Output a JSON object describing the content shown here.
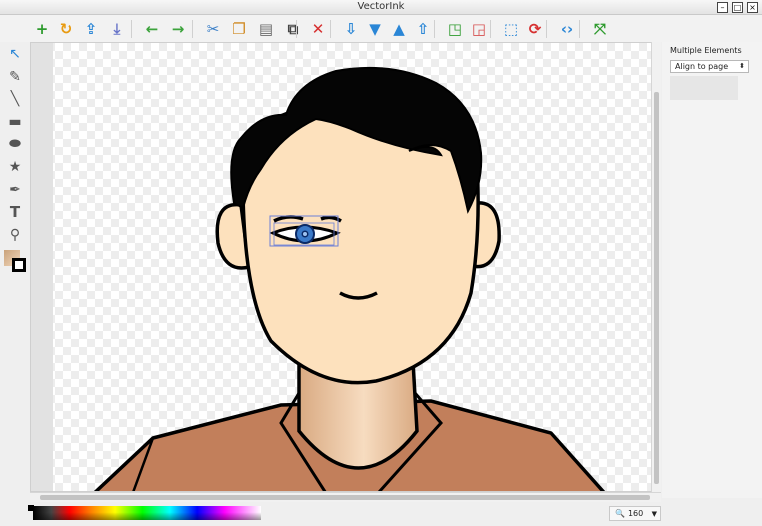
{
  "window": {
    "title": "VectorInk"
  },
  "toolbar": [
    {
      "name": "new-button",
      "glyph": "+",
      "color": "#2e9b2e"
    },
    {
      "name": "reload-button",
      "glyph": "↻",
      "color": "#e89b12"
    },
    {
      "name": "upload-button",
      "glyph": "⇪",
      "color": "#2a86d6"
    },
    {
      "name": "download-button",
      "glyph": "⤓",
      "color": "#6a76c9"
    },
    {
      "name": "undo-button",
      "glyph": "←",
      "color": "#3ca33c"
    },
    {
      "name": "redo-button",
      "glyph": "→",
      "color": "#3ca33c"
    },
    {
      "name": "cut-button",
      "glyph": "✂",
      "color": "#3a7fc8"
    },
    {
      "name": "copy-button",
      "glyph": "❐",
      "color": "#d08a22"
    },
    {
      "name": "paste-button",
      "glyph": "▤",
      "color": "#6a6a6a"
    },
    {
      "name": "clone-button",
      "glyph": "⧉",
      "color": "#444444"
    },
    {
      "name": "delete-button",
      "glyph": "✕",
      "color": "#d63030"
    },
    {
      "name": "move-bottom-button",
      "glyph": "⇩",
      "color": "#2a86d6"
    },
    {
      "name": "move-down-button",
      "glyph": "▼",
      "color": "#2a86d6"
    },
    {
      "name": "move-up-button",
      "glyph": "▲",
      "color": "#2a86d6"
    },
    {
      "name": "move-top-button",
      "glyph": "⇧",
      "color": "#2a86d6"
    },
    {
      "name": "group-button",
      "glyph": "◳",
      "color": "#2e9b2e"
    },
    {
      "name": "ungroup-button",
      "glyph": "◲",
      "color": "#d65050"
    },
    {
      "name": "crop-button",
      "glyph": "⬚",
      "color": "#2a86d6"
    },
    {
      "name": "rotate-button",
      "glyph": "⟳",
      "color": "#d63030"
    },
    {
      "name": "source-button",
      "glyph": "‹›",
      "color": "#2a86d6"
    },
    {
      "name": "fit-button",
      "glyph": "⤧",
      "color": "#2e9b2e"
    }
  ],
  "toolbox": [
    {
      "name": "select-tool-icon",
      "glyph": "↖",
      "color": "#2a86d6"
    },
    {
      "name": "pencil-tool-icon",
      "glyph": "✎",
      "color": "#555555"
    },
    {
      "name": "line-tool-icon",
      "glyph": "╲",
      "color": "#555555"
    },
    {
      "name": "rect-tool-icon",
      "glyph": "▬",
      "color": "#555555"
    },
    {
      "name": "ellipse-tool-icon",
      "glyph": "⬬",
      "color": "#555555"
    },
    {
      "name": "star-tool-icon",
      "glyph": "★",
      "color": "#555555"
    },
    {
      "name": "pen-tool-icon",
      "glyph": "✒",
      "color": "#555555"
    },
    {
      "name": "text-tool-icon",
      "glyph": "T",
      "color": "#555555"
    },
    {
      "name": "eyedropper-tool-icon",
      "glyph": "⚲",
      "color": "#555555"
    }
  ],
  "panel": {
    "heading": "Multiple Elements",
    "align_select": "Align to page"
  },
  "zoom": {
    "value": "160"
  },
  "colors": {
    "skin": "#fde1bd",
    "hair": "#050505",
    "shirt": "#c27f5b",
    "neck_light": "#f7dcc0",
    "neck_dark": "#d9aa82",
    "iris": "#3a79c8",
    "selection": "#6b7fd6"
  }
}
